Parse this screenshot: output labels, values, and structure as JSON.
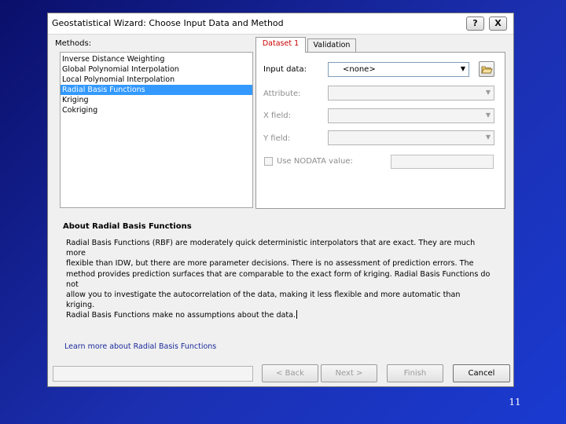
{
  "dialog": {
    "title": "Geostatistical Wizard: Choose Input Data and Method",
    "help_label": "?",
    "close_label": "X"
  },
  "methods": {
    "label": "Methods:",
    "items": [
      "Inverse Distance Weighting",
      "Global Polynomial Interpolation",
      "Local Polynomial Interpolation",
      "Radial Basis Functions",
      "Kriging",
      "Cokriging"
    ],
    "selected": "Radial Basis Functions"
  },
  "tabs": {
    "dataset": "Dataset 1",
    "validation": "Validation"
  },
  "dataset_form": {
    "input_data_label": "Input data:",
    "input_data_value": "<none>",
    "attribute_label": "Attribute:",
    "x_field_label": "X field:",
    "y_field_label": "Y field:",
    "nodata_label": "Use NODATA value:"
  },
  "about": {
    "heading": "About Radial Basis Functions",
    "lines": [
      "Radial Basis Functions (RBF) are moderately quick deterministic interpolators that are exact. They are much more",
      "flexible than IDW, but there are more parameter decisions. There is no assessment of prediction errors. The",
      "method provides prediction surfaces that are comparable to the exact form of kriging. Radial Basis Functions do not",
      "allow you to investigate the autocorrelation of the data, making it less flexible and more automatic than kriging.",
      "Radial Basis Functions make no assumptions about the data."
    ],
    "learn_more": "Learn more about Radial Basis Functions"
  },
  "buttons": {
    "back": "< Back",
    "next": "Next >",
    "finish": "Finish",
    "cancel": "Cancel"
  },
  "slide_number": "11"
}
